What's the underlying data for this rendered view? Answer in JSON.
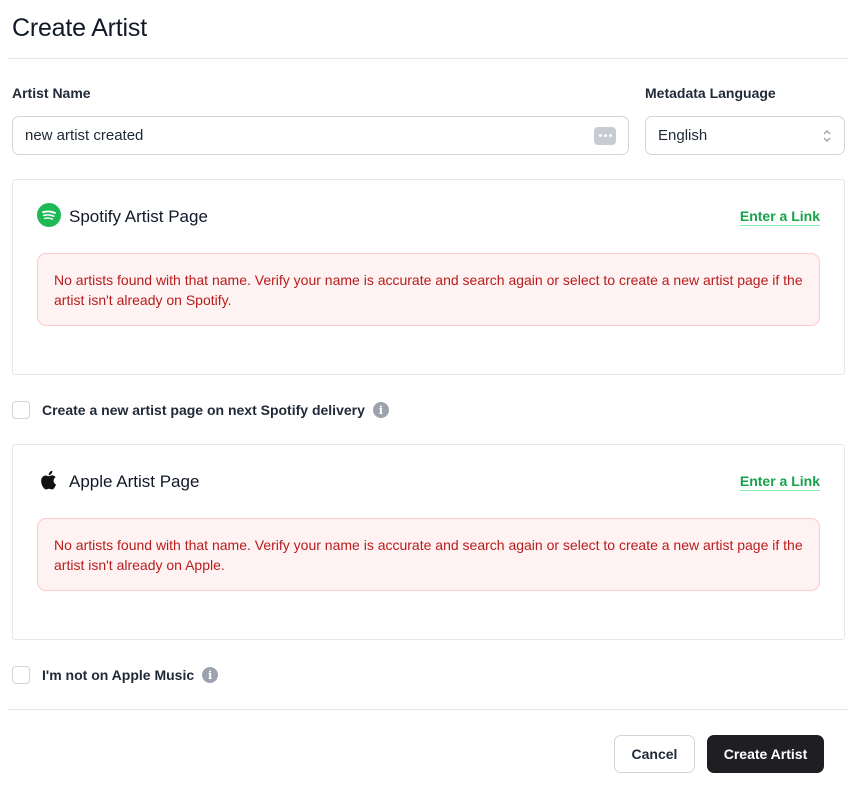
{
  "header": {
    "title": "Create Artist"
  },
  "form": {
    "artist_name": {
      "label": "Artist Name",
      "value": "new artist created",
      "icon": "more-dots-icon"
    },
    "metadata_language": {
      "label": "Metadata Language",
      "value": "English"
    }
  },
  "spotify": {
    "title": "Spotify Artist Page",
    "link_label": "Enter a Link",
    "error": "No artists found with that name. Verify your name is accurate and search again or select to create a new artist page if the artist isn't already on Spotify.",
    "brand_color": "#1DB954",
    "checkbox_label": "Create a new artist page on next Spotify delivery",
    "checked": false
  },
  "apple": {
    "title": "Apple Artist Page",
    "link_label": "Enter a Link",
    "error": "No artists found with that name. Verify your name is accurate and search again or select to create a new artist page if the artist isn't already on Apple.",
    "checkbox_label": "I'm not on Apple Music",
    "checked": false
  },
  "footer": {
    "cancel_label": "Cancel",
    "create_label": "Create Artist"
  },
  "colors": {
    "link": "#16a34a",
    "error_text": "#b91c1c",
    "error_bg": "#fef2f2",
    "primary_button": "#1f1f23"
  }
}
